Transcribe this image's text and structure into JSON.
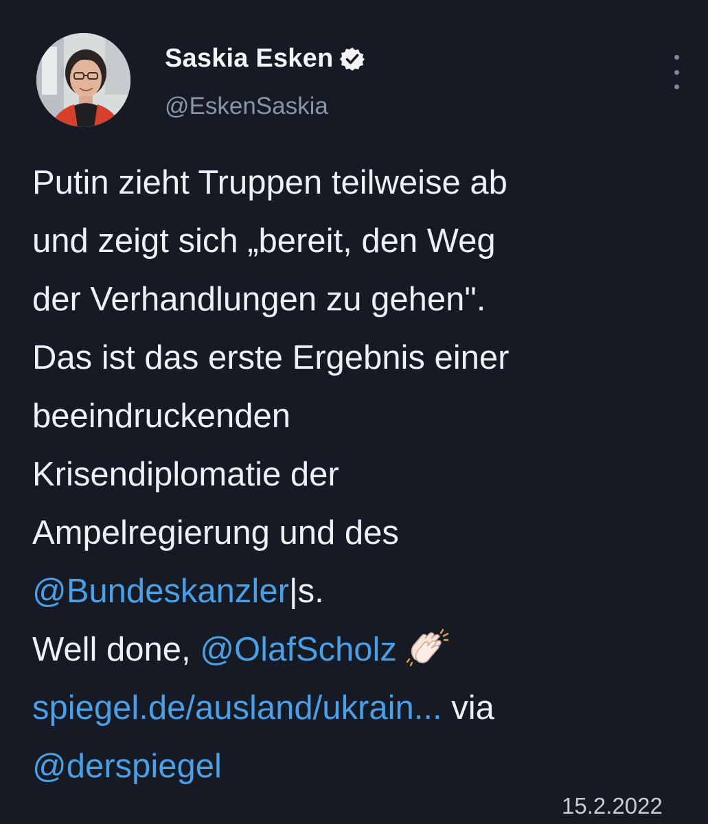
{
  "author": {
    "name": "Saskia Esken",
    "handle": "@EskenSaskia",
    "verified": true
  },
  "tweet": {
    "line1": "Putin zieht Truppen teilweise ab",
    "line2": "und zeigt sich „bereit, den Weg",
    "line3": "der Verhandlungen zu gehen\".",
    "line4": "Das ist das erste Ergebnis einer",
    "line5": "beeindruckenden",
    "line6": "Krisendiplomatie der",
    "line7": "Ampelregierung und des",
    "mention_bundeskanzler": "@Bundeskanzler",
    "mention_bundeskanzler_suffix": "|s.",
    "well_done": "Well done, ",
    "mention_olaf": "@OlafScholz",
    "clap_emoji": "clapping-hands-emoji",
    "link_text": "spiegel.de/ausland/ukrain...",
    "via": " via",
    "mention_spiegel": "@derspiegel"
  },
  "date_stamp": "15.2.2022",
  "icons": {
    "verified": "verified-badge-icon",
    "more": "more-options-icon"
  },
  "colors": {
    "background": "#151a24",
    "text": "#eef1f4",
    "handle": "#8a96a3",
    "link": "#4a9fe6"
  }
}
